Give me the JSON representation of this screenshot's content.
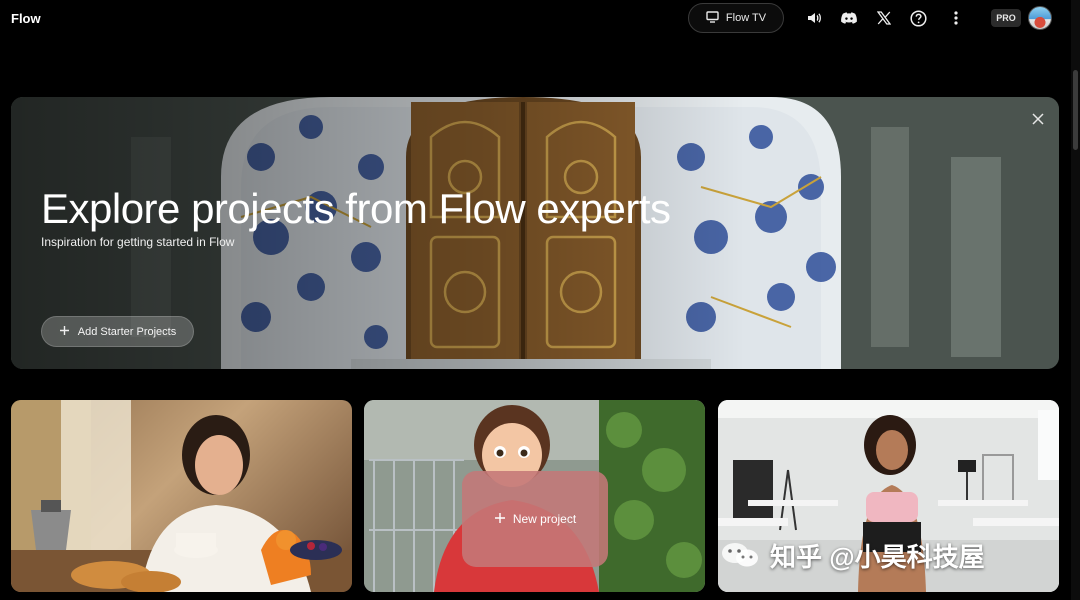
{
  "header": {
    "app_title": "Flow",
    "tv_label": "Flow TV",
    "plan_badge": "PRO"
  },
  "icons": {
    "tv": "tv-icon",
    "volume": "volume-icon",
    "discord": "discord-icon",
    "x": "x-logo-icon",
    "help": "help-icon",
    "more": "more-vertical-icon",
    "close": "close-icon",
    "add": "plus-icon"
  },
  "hero": {
    "title": "Explore projects from Flow experts",
    "subtitle": "Inspiration for getting started in Flow",
    "button_label": "Add Starter Projects"
  },
  "cards": {
    "new_project_label": "New project"
  },
  "watermark": {
    "text": "知乎 @小昊科技屋"
  },
  "colors": {
    "background": "#000000",
    "new_project_tile": "#c47878",
    "pro_badge": "#2b2b2b"
  }
}
